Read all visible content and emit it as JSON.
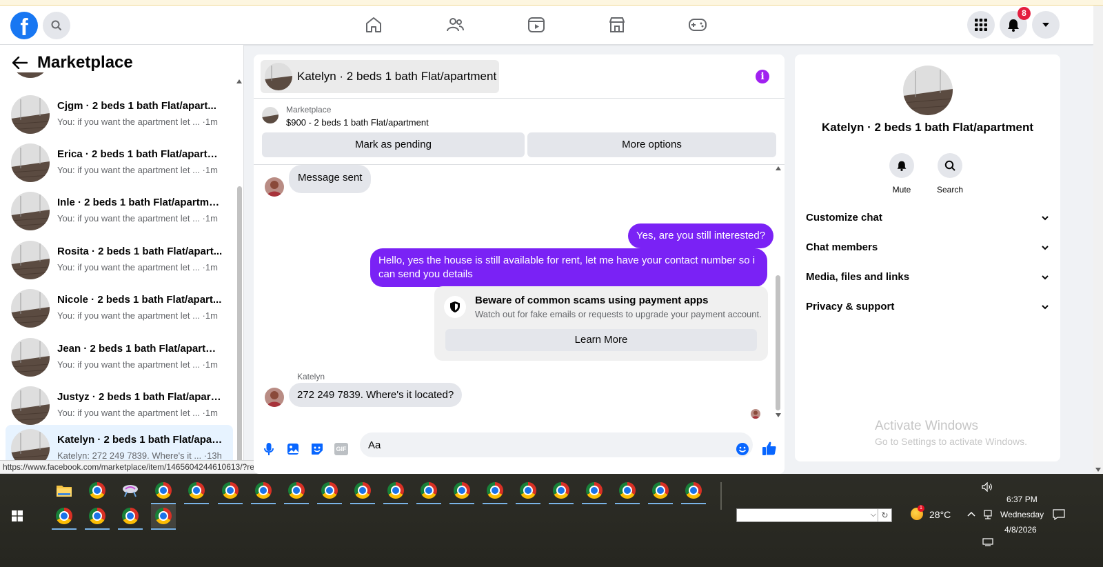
{
  "navbar": {
    "logo_letter": "f",
    "notification_count": "8"
  },
  "sidebar": {
    "title": "Marketplace",
    "threads": [
      {
        "name": "Cjgm · 2 beds 1 bath Flat/apart...",
        "snippet": "You: if you want the apartment let ... ·1m"
      },
      {
        "name": "Erica · 2 beds 1 bath Flat/apartm...",
        "snippet": "You: if you want the apartment let ... ·1m"
      },
      {
        "name": "Inle · 2 beds 1 bath Flat/apartme...",
        "snippet": "You: if you want the apartment let ... ·1m"
      },
      {
        "name": "Rosita · 2 beds 1 bath Flat/apart...",
        "snippet": "You: if you want the apartment let ... ·1m"
      },
      {
        "name": "Nicole · 2 beds 1 bath Flat/apart...",
        "snippet": "You: if you want the apartment let ... ·1m"
      },
      {
        "name": "Jean · 2 beds 1 bath Flat/apartm...",
        "snippet": "You: if you want the apartment let ... ·1m"
      },
      {
        "name": "Justyz · 2 beds 1 bath Flat/apart...",
        "snippet": "You: if you want the apartment let ... ·1m"
      },
      {
        "name": "Katelyn · 2 beds 1 bath Flat/apar...",
        "snippet": "Katelyn: 272 249 7839. Where's it ... ·13h"
      }
    ]
  },
  "status_url": "https://www.facebook.com/marketplace/item/1465604244610613/?referralSurface=messenger_...",
  "chat": {
    "title": "Katelyn · 2 beds 1 bath Flat/apartment",
    "listing_label": "Marketplace",
    "listing_desc": "$900 - 2 beds 1 bath Flat/apartment",
    "mark_pending": "Mark as pending",
    "more_options": "More options",
    "messages": {
      "m1": "Message sent",
      "m2": "Yes, are you still interested?",
      "m3": "Hello, yes the house is still available for rent, let me have your contact number so i can send you details",
      "scam_title": "Beware of common scams using payment apps",
      "scam_sub": "Watch out for fake emails or requests to upgrade your payment account.",
      "learn_more": "Learn More",
      "sender": "Katelyn",
      "m4": "272 249 7839. Where's it located?"
    },
    "composer_value": "Aa",
    "gif_label": "GIF"
  },
  "info_panel": {
    "name": "Katelyn · 2 beds 1 bath Flat/apartment",
    "mute": "Mute",
    "search": "Search",
    "rows": [
      "Customize chat",
      "Chat members",
      "Media, files and links",
      "Privacy & support"
    ],
    "watermark_title": "Activate Windows",
    "watermark_sub": "Go to Settings to activate Windows."
  },
  "taskbar": {
    "temperature": "28°C",
    "time": "6:37 PM",
    "day": "Wednesday",
    "date": "4/8/2026",
    "weather_badge": "1"
  },
  "colors": {
    "fb_blue": "#1877f2",
    "outgoing_bubble": "#7a22f5",
    "notification_red": "#e41e3f"
  }
}
